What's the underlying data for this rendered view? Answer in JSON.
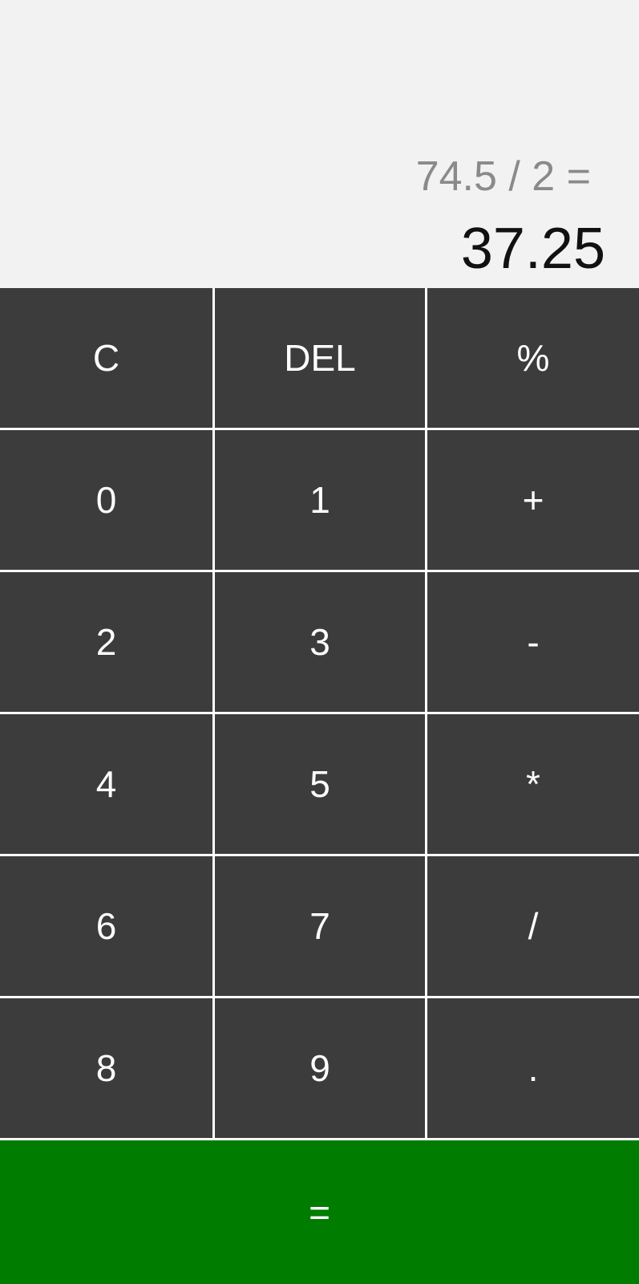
{
  "display": {
    "expression": "74.5 / 2 =",
    "result": "37.25"
  },
  "colors": {
    "display_bg": "#f2f2f2",
    "key_bg": "#3c3c3c",
    "equals_bg": "#007d00",
    "key_text": "#ffffff",
    "expression_text": "#8a8a8a",
    "result_text": "#111111"
  },
  "keys": {
    "clear": "C",
    "delete": "DEL",
    "percent": "%",
    "zero": "0",
    "one": "1",
    "plus": "+",
    "two": "2",
    "three": "3",
    "minus": "-",
    "four": "4",
    "five": "5",
    "multiply": "*",
    "six": "6",
    "seven": "7",
    "divide": "/",
    "eight": "8",
    "nine": "9",
    "decimal": ".",
    "equals": "="
  }
}
